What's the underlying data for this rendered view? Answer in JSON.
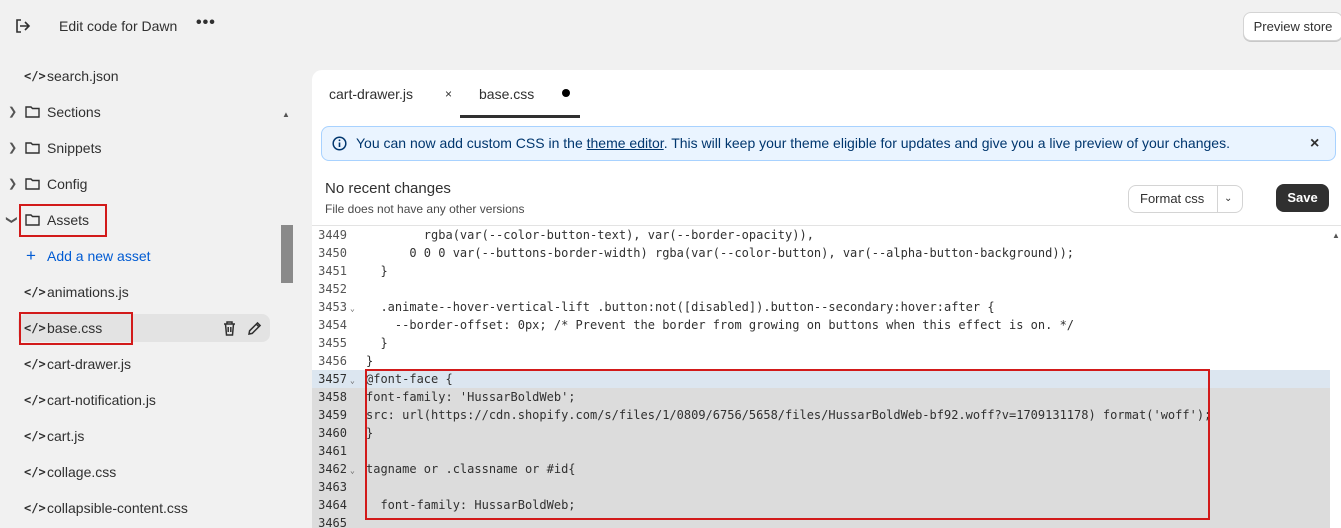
{
  "header": {
    "title": "Edit code for Dawn",
    "more_label": "•••",
    "preview_label": "Preview store"
  },
  "sidebar": {
    "items": [
      {
        "type": "file",
        "label": "search.json"
      },
      {
        "type": "folder",
        "label": "Sections"
      },
      {
        "type": "folder",
        "label": "Snippets"
      },
      {
        "type": "folder",
        "label": "Config"
      },
      {
        "type": "folder-open",
        "label": "Assets"
      },
      {
        "type": "add",
        "label": "Add a new asset"
      },
      {
        "type": "file",
        "label": "animations.js"
      },
      {
        "type": "file-selected",
        "label": "base.css"
      },
      {
        "type": "file",
        "label": "cart-drawer.js"
      },
      {
        "type": "file",
        "label": "cart-notification.js"
      },
      {
        "type": "file",
        "label": "cart.js"
      },
      {
        "type": "file",
        "label": "collage.css"
      },
      {
        "type": "file",
        "label": "collapsible-content.css"
      }
    ],
    "file_icon": "</>"
  },
  "tabs": [
    {
      "label": "cart-drawer.js",
      "close": "×"
    },
    {
      "label": "base.css",
      "modified": true
    }
  ],
  "banner": {
    "prefix": "You can now add custom CSS in the ",
    "link": "theme editor",
    "suffix": ". This will keep your theme eligible for updates and give you a live preview of your changes.",
    "close": "×"
  },
  "changes": {
    "title": "No recent changes",
    "subtitle": "File does not have any other versions"
  },
  "toolbar": {
    "format_label": "Format css",
    "save_label": "Save"
  },
  "code": {
    "lines": [
      {
        "n": "3449",
        "fold": false,
        "text": "        rgba(var(--color-button-text), var(--border-opacity)),"
      },
      {
        "n": "3450",
        "fold": false,
        "text": "      0 0 0 var(--buttons-border-width) rgba(var(--color-button), var(--alpha-button-background));"
      },
      {
        "n": "3451",
        "fold": false,
        "text": "  }"
      },
      {
        "n": "3452",
        "fold": false,
        "text": ""
      },
      {
        "n": "3453",
        "fold": true,
        "text": "  .animate--hover-vertical-lift .button:not([disabled]).button--secondary:hover:after {"
      },
      {
        "n": "3454",
        "fold": false,
        "text": "    --border-offset: 0px; /* Prevent the border from growing on buttons when this effect is on. */"
      },
      {
        "n": "3455",
        "fold": false,
        "text": "  }"
      },
      {
        "n": "3456",
        "fold": false,
        "text": "}"
      },
      {
        "n": "3457",
        "fold": true,
        "text": "@font-face {"
      },
      {
        "n": "3458",
        "fold": false,
        "text": "font-family: 'HussarBoldWeb';"
      },
      {
        "n": "3459",
        "fold": false,
        "text": "src: url(https://cdn.shopify.com/s/files/1/0809/6756/5658/files/HussarBoldWeb-bf92.woff?v=1709131178) format('woff');"
      },
      {
        "n": "3460",
        "fold": false,
        "text": "}"
      },
      {
        "n": "3461",
        "fold": false,
        "text": ""
      },
      {
        "n": "3462",
        "fold": true,
        "text": "tagname or .classname or #id{"
      },
      {
        "n": "3463",
        "fold": false,
        "text": ""
      },
      {
        "n": "3464",
        "fold": false,
        "text": "  font-family: HussarBoldWeb;"
      },
      {
        "n": "3465",
        "fold": false,
        "text": ""
      }
    ]
  },
  "icons": {
    "exit": "exit-icon",
    "folder": "folder-icon",
    "chevron": "chevron-right-icon",
    "info": "info-icon",
    "trash": "trash-icon",
    "pencil": "pencil-icon"
  },
  "colors": {
    "accent": "#005bd3",
    "highlight_box": "#d21a1a",
    "banner_bg": "#eaf4ff",
    "save_bg": "#303030"
  }
}
